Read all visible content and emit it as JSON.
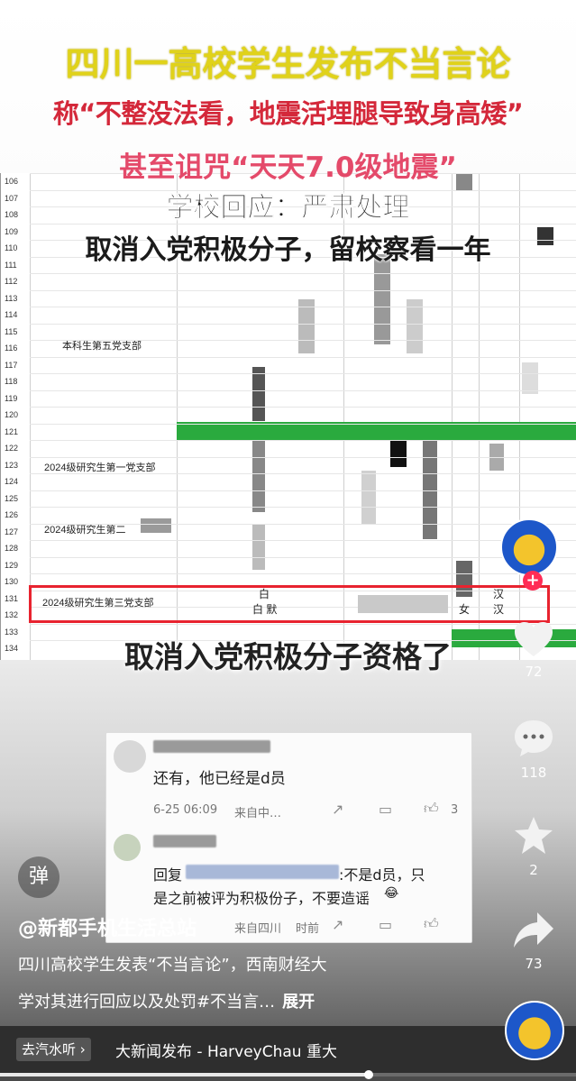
{
  "overlay": {
    "headline": "四川一高校学生发布不当言论",
    "line2": "称“不整没法看，地震活埋腿导致身高矮”",
    "line3": "甚至诅咒“天天7.0级地震”",
    "line4": "学校回应：严肃处理",
    "line5": "取消入党积极分子，留校察看一年",
    "bottom_caption": "取消入党积极分子资格了"
  },
  "sheet": {
    "row_numbers": [
      "106",
      "107",
      "108",
      "109",
      "110",
      "111",
      "112",
      "113",
      "114",
      "115",
      "116",
      "117",
      "118",
      "119",
      "120",
      "121",
      "122",
      "123",
      "124",
      "125",
      "126",
      "127",
      "128",
      "129",
      "130",
      "131",
      "132",
      "133",
      "134"
    ],
    "dept_labels": [
      "本科生第五党支部",
      "2024级研究生第一党支部",
      "2024级研究生第二",
      "2024级研究生第三党支部"
    ],
    "highlight_cells": {
      "name_top": "白",
      "name_bottom": "白 默",
      "gender": "女",
      "ethnicity_top": "汉",
      "ethnicity_bottom": "汉"
    },
    "accent_green": "#2aaa3e",
    "highlight_color": "#e8232f"
  },
  "comment_card": {
    "comment1_text": "还有，他已经是d员",
    "comment1_meta": "6-25 06:09",
    "comment1_from": "来自中…",
    "comment1_likes": "3",
    "reply_prefix": "回复",
    "reply_text1": ":不是d员，只",
    "reply_text2": "是之前被评为积极份子，不要造谣",
    "reply_emoji": "😂",
    "reply_from": "来自四川",
    "reply_time": "时前"
  },
  "rail": {
    "likes": "72",
    "comments": "118",
    "favorites": "2",
    "shares": "73"
  },
  "info": {
    "danmu": "弹",
    "author": "@新都手机生活总站",
    "desc_line1": "四川高校学生发表“不当言论”，西南财经大",
    "desc_line2": "学对其进行回应以及处罚#不当言…",
    "expand": "展开"
  },
  "music": {
    "chip": "去汽水听 ›",
    "title": "大新闻发布 - HarveyChau   重大"
  },
  "playback": {
    "progress_fraction": 0.64
  },
  "icons": [
    "heart-icon",
    "comment-icon",
    "star-icon",
    "share-icon",
    "plus-icon",
    "music-disc-icon"
  ]
}
